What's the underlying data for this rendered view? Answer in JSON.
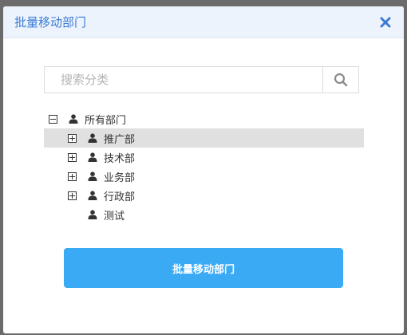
{
  "dialog": {
    "title": "批量移动部门",
    "close_icon": "close-icon",
    "accent_color": "#3a7bd5"
  },
  "search": {
    "placeholder": "搜索分类",
    "value": "",
    "icon": "search-icon"
  },
  "tree": {
    "root": {
      "label": "所有部门",
      "expanded": true,
      "icon": "user-icon"
    },
    "children": [
      {
        "label": "推广部",
        "expandable": true,
        "selected": true,
        "icon": "user-icon"
      },
      {
        "label": "技术部",
        "expandable": true,
        "selected": false,
        "icon": "user-icon"
      },
      {
        "label": "业务部",
        "expandable": true,
        "selected": false,
        "icon": "user-icon"
      },
      {
        "label": "行政部",
        "expandable": true,
        "selected": false,
        "icon": "user-icon"
      },
      {
        "label": "测试",
        "expandable": false,
        "selected": false,
        "icon": "user-icon"
      }
    ]
  },
  "actions": {
    "submit_label": "批量移动部门",
    "submit_color": "#3aaaf5"
  }
}
